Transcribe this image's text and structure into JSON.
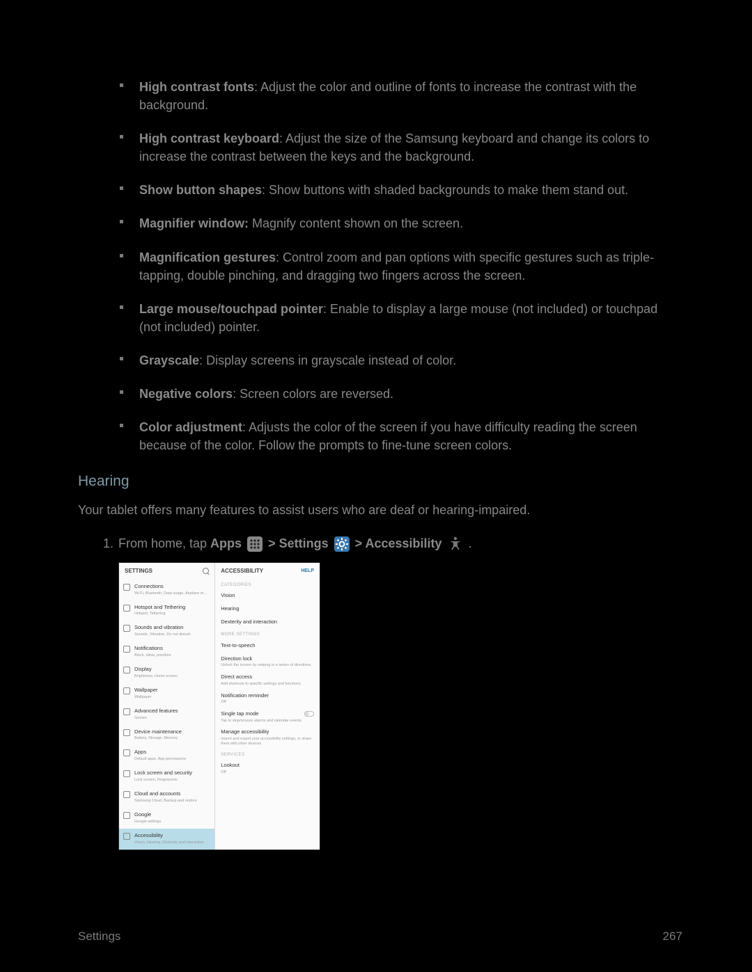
{
  "bullets": [
    {
      "term": "High contrast fonts",
      "desc": ": Adjust the color and outline of fonts to increase the contrast with the background."
    },
    {
      "term": "High contrast keyboard",
      "desc": ": Adjust the size of the Samsung keyboard and change its colors to increase the contrast between the keys and the background."
    },
    {
      "term": "Show button shapes",
      "desc": ": Show buttons with shaded backgrounds to make them stand out."
    },
    {
      "term": "Magnifier window:",
      "desc": " Magnify content shown on the screen."
    },
    {
      "term": "Magnification gestures",
      "desc": ": Control zoom and pan options with specific gestures such as triple-tapping, double pinching, and dragging two fingers across the screen."
    },
    {
      "term": "Large mouse/touchpad pointer",
      "desc": ": Enable to display a large mouse (not included) or touchpad (not included) pointer."
    },
    {
      "term": "Grayscale",
      "desc": ": Display screens in grayscale instead of color."
    },
    {
      "term": "Negative colors",
      "desc": ": Screen colors are reversed."
    },
    {
      "term": "Color adjustment",
      "desc": ": Adjusts the color of the screen if you have difficulty reading the screen because of the color. Follow the prompts to fine-tune screen colors."
    }
  ],
  "heading": "Hearing",
  "hearing_desc": "Your tablet offers many features to assist users who are deaf or hearing-impaired.",
  "step1": {
    "prefix": "From home, tap ",
    "apps": "Apps",
    "gt1": " > ",
    "settings": "Settings",
    "gt2": " > ",
    "accessibility": "Accessibility",
    "period": "."
  },
  "ss": {
    "settings": "SETTINGS",
    "accessibility": "ACCESSIBILITY",
    "help": "HELP",
    "categories": "CATEGORIES",
    "more": "MORE SETTINGS",
    "services": "SERVICES",
    "left": [
      {
        "t": "Connections",
        "s": "Wi-Fi, Bluetooth, Data usage, Airplane m..."
      },
      {
        "t": "Hotspot and Tethering",
        "s": "Hotspot, Tethering"
      },
      {
        "t": "Sounds and vibration",
        "s": "Sounds, Vibration, Do not disturb"
      },
      {
        "t": "Notifications",
        "s": "Block, allow, prioritize"
      },
      {
        "t": "Display",
        "s": "Brightness, Home screen"
      },
      {
        "t": "Wallpaper",
        "s": "Wallpaper"
      },
      {
        "t": "Advanced features",
        "s": "Games"
      },
      {
        "t": "Device maintenance",
        "s": "Battery, Storage, Memory"
      },
      {
        "t": "Apps",
        "s": "Default apps, App permissions"
      },
      {
        "t": "Lock screen and security",
        "s": "Lock screen, Fingerprints"
      },
      {
        "t": "Cloud and accounts",
        "s": "Samsung Cloud, Backup and restore"
      },
      {
        "t": "Google",
        "s": "Google settings"
      },
      {
        "t": "Accessibility",
        "s": "Vision, Hearing, Dexterity and interaction"
      }
    ],
    "right": [
      {
        "t": "Vision",
        "s": ""
      },
      {
        "t": "Hearing",
        "s": ""
      },
      {
        "t": "Dexterity and interaction",
        "s": ""
      },
      {
        "t": "Text-to-speech",
        "s": ""
      },
      {
        "t": "Direction lock",
        "s": "Unlock the screen by swiping in a series of directions."
      },
      {
        "t": "Direct access",
        "s": "Add shortcuts to specific settings and functions."
      },
      {
        "t": "Notification reminder",
        "s": "Off"
      },
      {
        "t": "Single tap mode",
        "s": "Tap to stop/snooze alarms and calendar events."
      },
      {
        "t": "Manage accessibility",
        "s": "Import and export your accessibility settings, or share them with other devices."
      },
      {
        "t": "Lookout",
        "s": "Off"
      }
    ]
  },
  "footer": {
    "left": "Settings",
    "right": "267"
  }
}
